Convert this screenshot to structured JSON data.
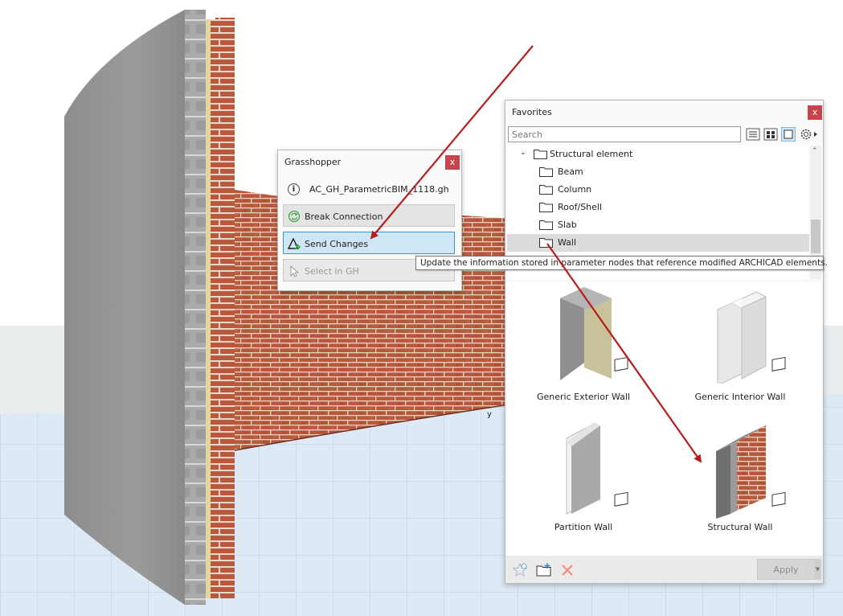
{
  "grasshopper": {
    "title": "Grasshopper",
    "close": "x",
    "file_name": "AC_GH_ParametricBIM_1118.gh",
    "buttons": [
      {
        "label": "Break Connection"
      },
      {
        "label": "Send Changes"
      },
      {
        "label": "Select in GH"
      }
    ]
  },
  "favorites": {
    "title": "Favorites",
    "close": "x",
    "search_placeholder": "Search",
    "tree": {
      "parent": "Structural element",
      "children": [
        "Beam",
        "Column",
        "Roof/Shell",
        "Slab",
        "Wall"
      ],
      "selected": "Wall"
    },
    "tiles": [
      {
        "label": "Generic Exterior Wall"
      },
      {
        "label": "Generic Interior Wall"
      },
      {
        "label": "Partition Wall"
      },
      {
        "label": "Structural Wall"
      }
    ],
    "apply_label": "Apply"
  },
  "tooltip": "Update the information stored in parameter nodes that reference modified ARCHICAD elements.",
  "axis_label": "y",
  "colors": {
    "close_button": "#c8444c",
    "selection": "#cfe6f7",
    "selection_border": "#3d8fd6",
    "arrow": "#b81c1c",
    "brick": "#b5553a",
    "grid": "#c9dcef"
  }
}
